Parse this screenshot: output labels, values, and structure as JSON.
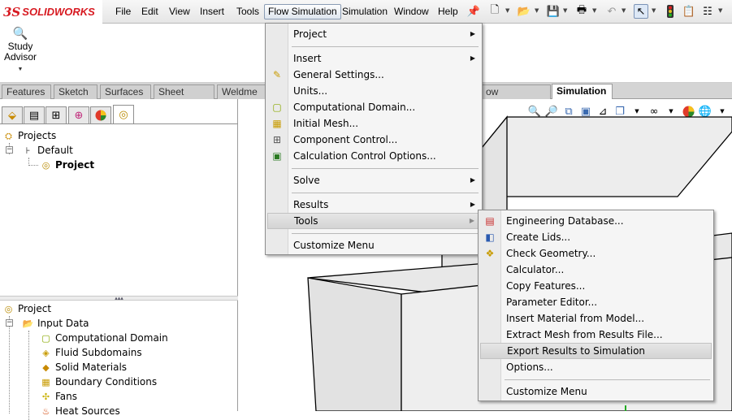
{
  "app": {
    "logo_prefix": "3S",
    "logo_name": "SOLIDWORKS"
  },
  "menubar": {
    "items": [
      {
        "label": "File"
      },
      {
        "label": "Edit"
      },
      {
        "label": "View"
      },
      {
        "label": "Insert"
      },
      {
        "label": "Tools"
      },
      {
        "label": "Flow Simulation"
      },
      {
        "label": "Simulation"
      },
      {
        "label": "Window"
      },
      {
        "label": "Help"
      }
    ]
  },
  "command_manager": {
    "study_advisor": {
      "line1": "Study",
      "line2": "Advisor"
    }
  },
  "tabs": [
    {
      "label": "Features"
    },
    {
      "label": "Sketch"
    },
    {
      "label": "Surfaces"
    },
    {
      "label": "Sheet Metal"
    },
    {
      "label": "Weldme"
    },
    {
      "label": "ow Simulation"
    },
    {
      "label": "Simulation"
    }
  ],
  "tree_top": {
    "projects": "Projects",
    "default": "Default",
    "project": "Project"
  },
  "tree_bottom": {
    "project": "Project",
    "input_data": "Input Data",
    "items": [
      {
        "label": "Computational Domain"
      },
      {
        "label": "Fluid Subdomains"
      },
      {
        "label": "Solid Materials"
      },
      {
        "label": "Boundary Conditions"
      },
      {
        "label": "Fans"
      },
      {
        "label": "Heat Sources"
      }
    ]
  },
  "flow_menu": {
    "items": [
      {
        "label": "Project"
      },
      {
        "label": "Insert"
      },
      {
        "label": "General Settings..."
      },
      {
        "label": "Units..."
      },
      {
        "label": "Computational Domain..."
      },
      {
        "label": "Initial Mesh..."
      },
      {
        "label": "Component Control..."
      },
      {
        "label": "Calculation Control Options..."
      },
      {
        "label": "Solve"
      },
      {
        "label": "Results"
      },
      {
        "label": "Tools"
      },
      {
        "label": "Customize Menu"
      }
    ]
  },
  "tools_submenu": {
    "items": [
      {
        "label": "Engineering Database..."
      },
      {
        "label": "Create Lids..."
      },
      {
        "label": "Check Geometry..."
      },
      {
        "label": "Calculator..."
      },
      {
        "label": "Copy Features..."
      },
      {
        "label": "Parameter Editor..."
      },
      {
        "label": "Insert Material from Model..."
      },
      {
        "label": "Extract Mesh from Results File..."
      },
      {
        "label": "Export Results to Simulation"
      },
      {
        "label": "Options..."
      },
      {
        "label": "Customize Menu"
      }
    ]
  },
  "colors": {
    "brand": "#d71920",
    "menu_bg": "#f5f5f5",
    "model_face": "#e6e6e6"
  }
}
